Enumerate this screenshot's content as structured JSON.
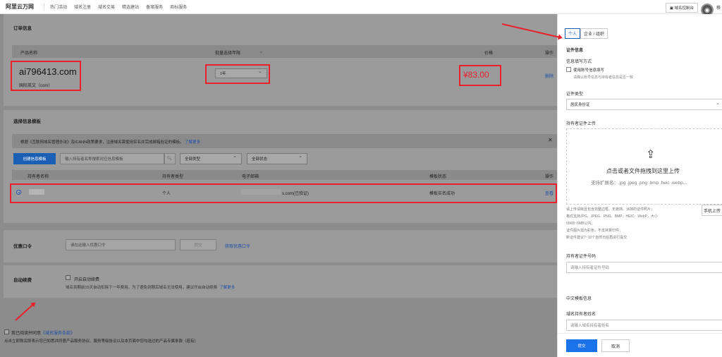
{
  "topbar": {
    "logo": "阿里云万网",
    "nav": [
      "热门活动",
      "域名注册",
      "域名交易",
      "精选建站",
      "备案服务",
      "商标服务"
    ],
    "console": "域名控制台",
    "user": "移"
  },
  "order": {
    "title": "订单信息",
    "col_name": "产品名称",
    "col_years": "批量选择年限",
    "col_price": "价格",
    "col_action": "操作",
    "domain": "ai796413.com",
    "domain_type": "国际英文（com）",
    "years": "1年",
    "price": "¥83.00",
    "delete": "删除"
  },
  "template": {
    "title": "选择信息模板",
    "notice": "根据《互联网域名管理办法》及ICANN政策要求，注册域名需使用实名并完成邮箱验证的模板。",
    "notice_link": "了解更多",
    "create_btn": "创建信息模板",
    "search_placeholder": "输入持有者名称搜索对应信息模板",
    "filter_type": "全部类型",
    "filter_status": "全部状态",
    "cols": [
      "持有者名称",
      "持有者类型",
      "电子邮箱",
      "模板状态",
      "操作"
    ],
    "row": {
      "type": "个人",
      "email": "s.com(已验证)",
      "status": "模板实名成功",
      "action": "查看"
    }
  },
  "coupon": {
    "title": "优惠口令",
    "placeholder": "请在此输入优惠口令",
    "submit": "提交",
    "link": "获取优惠口令"
  },
  "renew": {
    "title": "自动续费",
    "checkbox": "开启自动续费",
    "desc": "域名到期前15天自动扣除下一年费用。为了避免到期后域名无法使用，建议开启自动续费",
    "link": "了解更多"
  },
  "agree": {
    "text": "我已阅读并同意",
    "link": "《域名服务条款》",
    "footer": "点击立即购买即表示您已知悉并同意产品服务协议、服务等级协议以及本页面中您勾选过的产品专属条款（若有）"
  },
  "drawer": {
    "tab_personal": "个人",
    "tab_org": "企业 / 组织",
    "cert_title": "证件信息",
    "fill_mode": "信息填写方式",
    "use_account": "使用账号信息填写",
    "use_account_hint": "请确认账号信息与持有者信息是否一致",
    "cert_type_label": "证件类型",
    "cert_type_value": "居民身份证",
    "upload_label": "持有者证件上传",
    "upload_text": "点击或者文件拖拽到这里上传",
    "upload_ext": "支持扩展名：.jpg .jpeg .png .bmp .heic .webp...",
    "upload_notes": [
      "请上传请晰且包含完整边框、无遮挡、涂抹的证件照片；",
      "格式支持JPG、JPEG、PNG、BMP、HEIC、WebP，大小",
      "55KB~5MB以内；",
      "证件图片需为彩色，不支持复印件；",
      "新证件建议7~10个自然日后再进行提交"
    ],
    "mobile_upload": "手机上传",
    "id_label": "持有者证件号码",
    "id_placeholder": "请输入持有者证件号码",
    "cn_template": "中文模板信息",
    "name_label": "域名持有者姓名",
    "name_placeholder": "请输入域名持有者姓名",
    "submit": "提交",
    "cancel": "取消"
  }
}
